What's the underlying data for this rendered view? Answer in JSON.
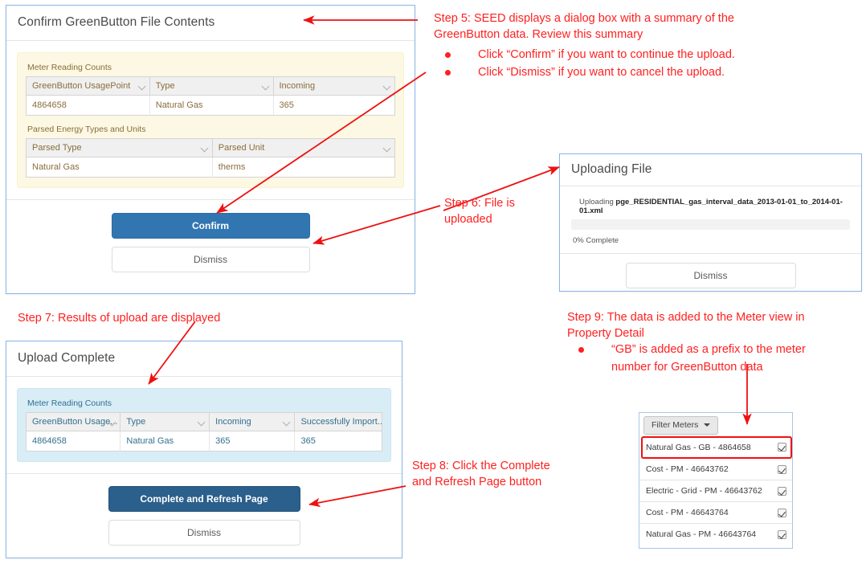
{
  "confirm_dialog": {
    "title": "Confirm GreenButton File Contents",
    "meter_counts": {
      "label": "Meter Reading Counts",
      "columns": [
        "GreenButton UsagePoint",
        "Type",
        "Incoming"
      ],
      "rows": [
        [
          "4864658",
          "Natural Gas",
          "365"
        ]
      ]
    },
    "parsed_types": {
      "label": "Parsed Energy Types and Units",
      "columns": [
        "Parsed Type",
        "Parsed Unit"
      ],
      "rows": [
        [
          "Natural Gas",
          "therms"
        ]
      ]
    },
    "confirm_label": "Confirm",
    "dismiss_label": "Dismiss"
  },
  "uploading_dialog": {
    "title": "Uploading File",
    "uploading_prefix": "Uploading ",
    "filename": "pge_RESIDENTIAL_gas_interval_data_2013-01-01_to_2014-01-01.xml",
    "progress_percent": 0,
    "progress_text": "0% Complete",
    "dismiss_label": "Dismiss"
  },
  "complete_dialog": {
    "title": "Upload Complete",
    "meter_counts": {
      "label": "Meter Reading Counts",
      "columns": [
        "GreenButton Usage...",
        "Type",
        "Incoming",
        "Successfully Import..."
      ],
      "rows": [
        [
          "4864658",
          "Natural Gas",
          "365",
          "365"
        ]
      ]
    },
    "refresh_label": "Complete and Refresh Page",
    "dismiss_label": "Dismiss"
  },
  "filter_meters": {
    "button_label": "Filter Meters",
    "meters": [
      {
        "label": "Natural Gas - GB - 4864658",
        "checked": true
      },
      {
        "label": "Cost - PM - 46643762",
        "checked": true
      },
      {
        "label": "Electric - Grid - PM - 46643762",
        "checked": true
      },
      {
        "label": "Cost - PM - 46643764",
        "checked": true
      },
      {
        "label": "Natural Gas - PM - 46643764",
        "checked": true
      }
    ]
  },
  "annotations": {
    "step5": "Step 5: SEED displays a dialog box with a summary of the\nGreenButton data. Review this summary",
    "step5_bullets": [
      "Click “Confirm” if you want to continue the upload.",
      "Click “Dismiss” if you want to cancel the upload."
    ],
    "step6": "Step 6: File is\nuploaded",
    "step7": "Step 7: Results of upload are displayed",
    "step8": "Step 8: Click the Complete\nand Refresh Page button",
    "step9": "Step 9: The data is added to the Meter view in\nProperty Detail",
    "step9_bullets": [
      "“GB” is added as a prefix to the meter\nnumber for GreenButton data"
    ]
  },
  "colors": {
    "annotation_red": "#ff2020",
    "primary_blue": "#3276b1",
    "navy_blue": "#2b5f8c",
    "warning_bg": "#fcf8e3",
    "warning_text": "#8a6d3b",
    "info_bg": "#d9edf7",
    "info_text": "#31708f"
  }
}
